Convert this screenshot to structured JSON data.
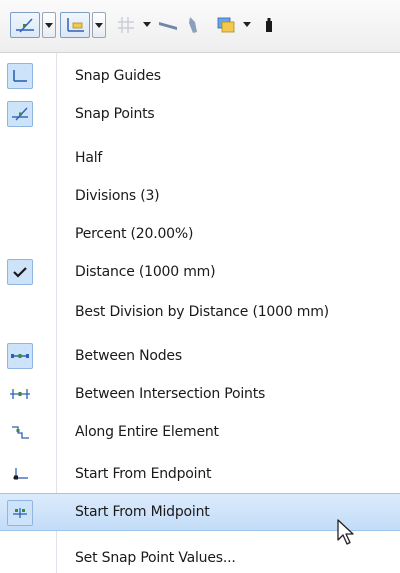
{
  "toolbar": {
    "buttons": [
      {
        "name": "snap-points-toolbar",
        "icon": "snap-points-icon",
        "pressed": true,
        "has_dropdown": true
      },
      {
        "name": "snap-guides-toolbar",
        "icon": "snap-guides-icon",
        "pressed": true,
        "has_dropdown": true
      },
      {
        "name": "grid-toolbar",
        "icon": "grid-icon",
        "pressed": false,
        "has_dropdown": true
      },
      {
        "name": "slope-toolbar",
        "icon": "slope-line-icon",
        "pressed": false,
        "has_dropdown": false
      },
      {
        "name": "pen-toolbar",
        "icon": "pen-icon",
        "pressed": false,
        "has_dropdown": false
      },
      {
        "name": "layers-toolbar",
        "icon": "layers-icon",
        "pressed": false,
        "has_dropdown": true
      },
      {
        "name": "marker-toolbar",
        "icon": "marker-icon",
        "pressed": false,
        "has_dropdown": false
      }
    ]
  },
  "menu": {
    "items": [
      {
        "label": "Snap Guides",
        "icon": "snap-guides-icon",
        "checked": true,
        "hover": false
      },
      {
        "label": "Snap Points",
        "icon": "snap-points-icon",
        "checked": true,
        "hover": false
      },
      {
        "label": "Half",
        "icon": "",
        "checked": false,
        "hover": false
      },
      {
        "label": "Divisions (3)",
        "icon": "",
        "checked": false,
        "hover": false
      },
      {
        "label": "Percent (20.00%)",
        "icon": "",
        "checked": false,
        "hover": false
      },
      {
        "label": "Distance (1000 mm)",
        "icon": "checkmark-icon",
        "checked": true,
        "hover": false
      },
      {
        "label": "Best Division by Distance (1000 mm)",
        "icon": "",
        "checked": false,
        "hover": false
      },
      {
        "label": "Between Nodes",
        "icon": "between-nodes-icon",
        "checked": true,
        "hover": false
      },
      {
        "label": "Between Intersection Points",
        "icon": "between-intersections-icon",
        "checked": false,
        "hover": false
      },
      {
        "label": "Along Entire Element",
        "icon": "along-element-icon",
        "checked": false,
        "hover": false
      },
      {
        "label": "Start From Endpoint",
        "icon": "start-endpoint-icon",
        "checked": false,
        "hover": false
      },
      {
        "label": "Start From Midpoint",
        "icon": "start-midpoint-icon",
        "checked": true,
        "hover": true
      },
      {
        "label": "Set Snap Point Values...",
        "icon": "",
        "checked": false,
        "hover": false
      }
    ]
  },
  "colors": {
    "check_bg": "#cde3fa",
    "hover_bg": "#c3dcf8",
    "accent": "#3a78c9"
  }
}
